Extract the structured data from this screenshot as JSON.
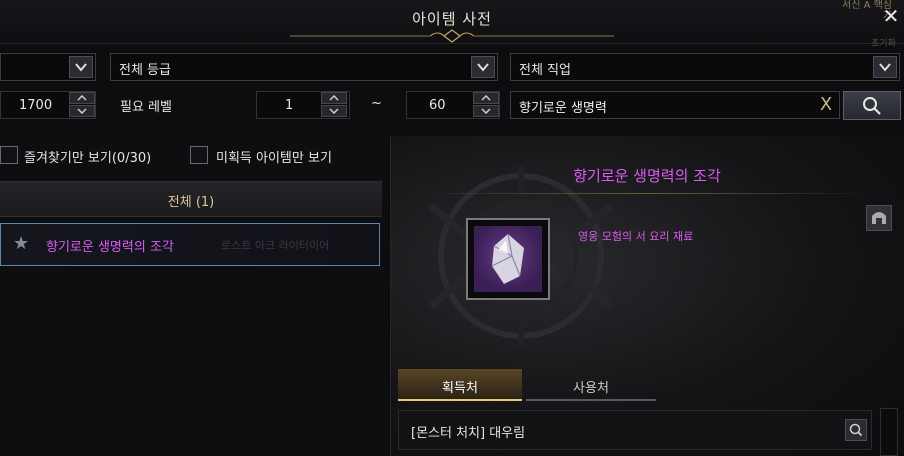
{
  "window": {
    "title": "아이템 사전",
    "corner_text": "서신 A 핵심가",
    "corner_sub": "초기화"
  },
  "filters": {
    "category_dropdown": {
      "label": "",
      "icon": "chevron-down-icon"
    },
    "grade_dropdown": {
      "label": "전체 등급",
      "icon": "chevron-down-icon"
    },
    "class_dropdown": {
      "label": "전체 직업",
      "icon": "chevron-down-icon"
    },
    "item_level_value": "1700",
    "required_level_label": "필요 레벨",
    "level_min": "1",
    "level_tilde": "~",
    "level_max": "60",
    "search_value": "향기로운 생명력",
    "clear_icon": "X"
  },
  "options": {
    "favorites_label": "즐겨찾기만 보기(0/30)",
    "unobtained_label": "미획득 아이템만 보기"
  },
  "list": {
    "header": "전체 (1)",
    "items": [
      {
        "name": "향기로운 생명력의 조각",
        "ghost_text": "로스트 아크 라이터이어"
      }
    ]
  },
  "detail": {
    "title": "향기로운 생명력의 조각",
    "description": "영웅 모험의 서 요리 재료",
    "tabs": [
      {
        "label": "획득처",
        "active": true
      },
      {
        "label": "사용처",
        "active": false
      }
    ],
    "sources": [
      {
        "label": "[몬스터 처치] 대우림"
      }
    ]
  },
  "colors": {
    "accent_gold": "#e7c873",
    "item_name_purple": "#d85cf0",
    "selection_border": "#5d85ad"
  }
}
